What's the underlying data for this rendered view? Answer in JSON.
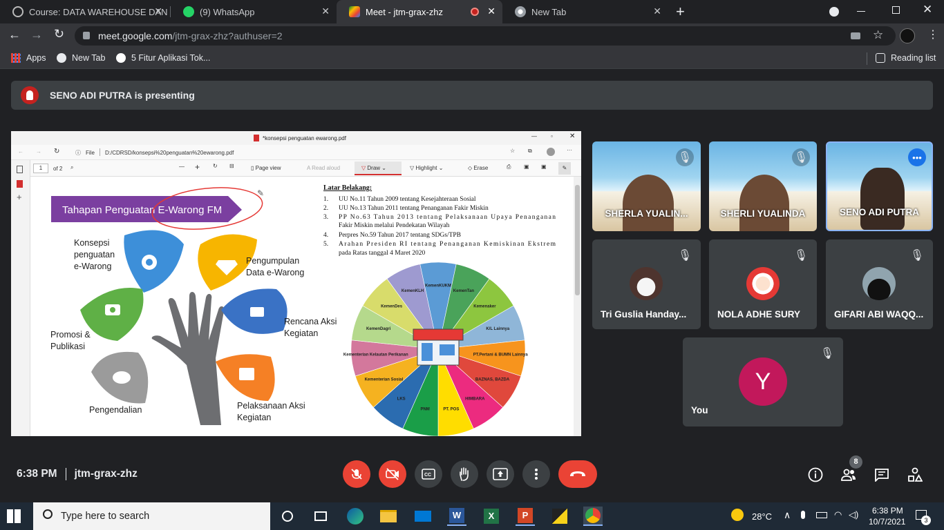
{
  "browser": {
    "tabs": [
      {
        "label": "Course: DATA WAREHOUSE DAN",
        "color": "#202124"
      },
      {
        "label": "(9) WhatsApp",
        "color": "#25d366"
      },
      {
        "label": "Meet - jtm-grax-zhz",
        "color": "#00897b"
      },
      {
        "label": "New Tab",
        "color": "#5f6368"
      }
    ],
    "url_host": "meet.google.com",
    "url_path": "/jtm-grax-zhz?authuser=2",
    "bookmarks": [
      "Apps",
      "New Tab",
      "5 Fitur Aplikasi Tok..."
    ],
    "reading_list": "Reading list"
  },
  "meet": {
    "presenter_banner": "SENO ADI PUTRA is presenting",
    "time": "6:38 PM",
    "meeting_code": "jtm-grax-zhz",
    "participant_count": "8",
    "participants": [
      {
        "name": "SHERLA YUALIN...",
        "tile": "video"
      },
      {
        "name": "SHERLI YUALINDA",
        "tile": "video"
      },
      {
        "name": "SENO ADI PUTRA",
        "tile": "video-active"
      },
      {
        "name": "Tri Guslia Handay...",
        "tile": "avatar",
        "avatar_color": "#6d4c41"
      },
      {
        "name": "NOLA ADHE SURY",
        "tile": "avatar",
        "avatar_color": "#e53935"
      },
      {
        "name": "GIFARI ABI WAQQ...",
        "tile": "avatar",
        "avatar_color": "#263238"
      },
      {
        "name": "You",
        "tile": "letter",
        "letter": "Y",
        "avatar_color": "#c2185b"
      }
    ],
    "accent": "#8ab4f8",
    "danger": "#ea4335"
  },
  "pdf": {
    "window_title": "*konsepsi penguatan ewarong.pdf",
    "address_prefix": "File",
    "address": "D:/CDRSD/konsepsi%20penguatan%20ewarong.pdf",
    "page_current": "1",
    "page_total": "of 2",
    "tools": {
      "page_view": "Page view",
      "read_aloud": "Read aloud",
      "draw": "Draw",
      "highlight": "Highlight",
      "erase": "Erase"
    },
    "slide": {
      "banner": "Tahapan Penguatan E-Warong FM",
      "labels": {
        "konsepsi": "Konsepsi\npenguatan\ne-Warong",
        "pengumpulan": "Pengumpulan\nData e-Warong",
        "promosi": "Promosi &\nPublikasi",
        "rencana": "Rencana Aksi\nKegiatan",
        "pengendalian": "Pengendalian",
        "pelaksanaan": "Pelaksanaan Aksi\nKegiatan"
      },
      "background_title": "Latar Belakang:",
      "background_items": [
        {
          "n": "1.",
          "text": "UU No.11 Tahun 2009 tentang Kesejahteraan Sosial"
        },
        {
          "n": "2.",
          "text": "UU No.13 Tahun 2011 tentang Penanganan Fakir Miskin"
        },
        {
          "n": "3.",
          "text": "PP No.63 Tahun 2013 tentang Pelaksanaan Upaya Penanganan Fakir Miskin melalui Pendekatan Wilayah"
        },
        {
          "n": "4.",
          "text": "Perpres No.59 Tahun 2017 tentang SDGs/TPB"
        },
        {
          "n": "5.",
          "text": "Arahan Presiden RI tentang Penanganan Kemiskinan Ekstrem pada Ratas tanggal 4 Maret 2020"
        }
      ],
      "wheel_segments": [
        {
          "label": "KemenKLH",
          "color": "#9e9ad0"
        },
        {
          "label": "KemenKUKM",
          "color": "#5b9bd5"
        },
        {
          "label": "KemenTan",
          "color": "#4aa35a"
        },
        {
          "label": "Kemenaker",
          "color": "#8dc63f"
        },
        {
          "label": "K/L Lainnya",
          "color": "#8fb6d8"
        },
        {
          "label": "PT.Pertani & BUMN Lainnya",
          "color": "#f7941d"
        },
        {
          "label": "BAZNAS, BAZDA",
          "color": "#e0483c"
        },
        {
          "label": "HIMBARA",
          "color": "#ec2b7f"
        },
        {
          "label": "PT. POS",
          "color": "#ffdd00"
        },
        {
          "label": "PNM",
          "color": "#1a9e48"
        },
        {
          "label": "LKS",
          "color": "#2b6cb0"
        },
        {
          "label": "Kementerian Sosial",
          "color": "#f5b220"
        },
        {
          "label": "Kementerian Kelautan Perikanan",
          "color": "#d3789c"
        },
        {
          "label": "KemenDagri",
          "color": "#b5d98c"
        },
        {
          "label": "KemenDes",
          "color": "#d8dc6b"
        }
      ]
    }
  },
  "taskbar": {
    "search_placeholder": "Type here to search",
    "weather": "28°C",
    "clock_time": "6:38 PM",
    "clock_date": "10/7/2021",
    "notifications": "3"
  }
}
